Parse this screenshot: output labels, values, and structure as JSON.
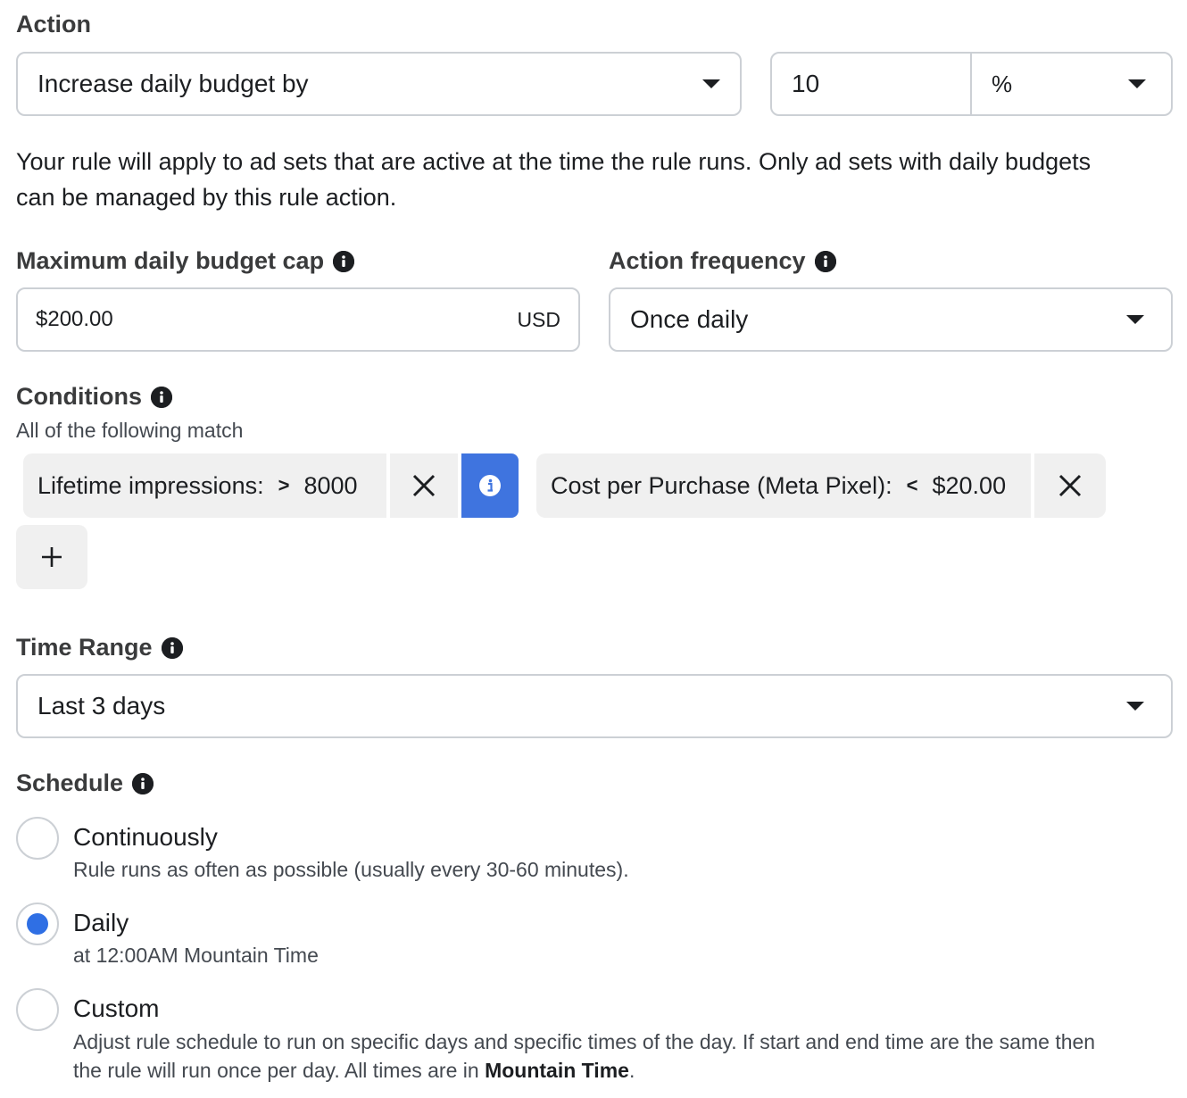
{
  "action": {
    "heading": "Action",
    "type_value": "Increase daily budget by",
    "amount_value": "10",
    "unit_value": "%",
    "helper_line1": "Your rule will apply to ad sets that are active at the time the rule runs. Only ad sets with daily budgets",
    "helper_line2": "can be managed by this rule action."
  },
  "budget_cap": {
    "heading": "Maximum daily budget cap",
    "value": "$200.00",
    "currency": "USD"
  },
  "frequency": {
    "heading": "Action frequency",
    "value": "Once daily"
  },
  "conditions": {
    "heading": "Conditions",
    "subtitle": "All of the following match",
    "items": [
      {
        "metric": "Lifetime impressions:",
        "operator": ">",
        "value": "8000"
      },
      {
        "metric": "Cost per Purchase (Meta Pixel):",
        "operator": "<",
        "value": "$20.00"
      }
    ],
    "add_label": "+"
  },
  "time_range": {
    "heading": "Time Range",
    "value": "Last 3 days"
  },
  "schedule": {
    "heading": "Schedule",
    "options": [
      {
        "label": "Continuously",
        "description": "Rule runs as often as possible (usually every 30-60 minutes).",
        "selected": false
      },
      {
        "label": "Daily",
        "description": "at 12:00AM Mountain Time",
        "selected": true
      },
      {
        "label": "Custom",
        "description_line1": "Adjust rule schedule to run on specific days and specific times of the day. If start and end time are the same then",
        "description_line2_prefix": "the rule will run once per day. All times are in ",
        "description_line2_bold": "Mountain Time",
        "description_line2_suffix": ".",
        "selected": false
      }
    ]
  },
  "colors": {
    "accent": "#3f74df",
    "radio_selected": "#2f6fe4",
    "border": "#ccd0d5",
    "chip_bg": "#f0f0f0"
  }
}
